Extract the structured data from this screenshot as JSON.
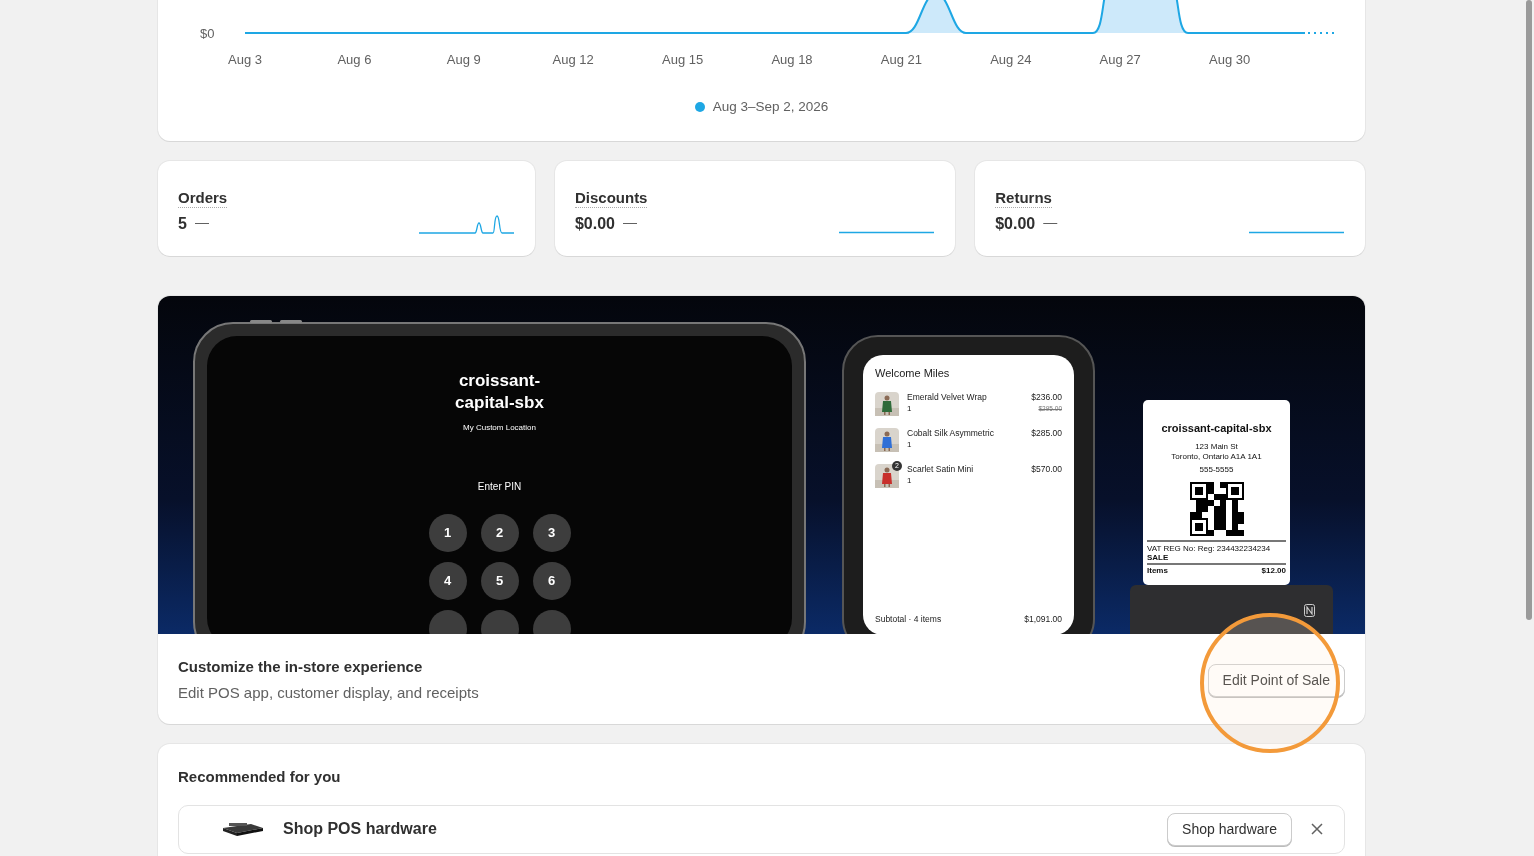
{
  "sales_chart": {
    "y_tick": "$0",
    "x_labels": [
      "Aug 3",
      "Aug 6",
      "Aug 9",
      "Aug 12",
      "Aug 15",
      "Aug 18",
      "Aug 21",
      "Aug 24",
      "Aug 27",
      "Aug 30"
    ],
    "legend": {
      "label": "Aug 3–Sep 2, 2026",
      "color": "#1ea7e4"
    }
  },
  "metrics": [
    {
      "title": "Orders",
      "value": "5",
      "change": "—",
      "kind": "peaks"
    },
    {
      "title": "Discounts",
      "value": "$0.00",
      "change": "—",
      "kind": "flat"
    },
    {
      "title": "Returns",
      "value": "$0.00",
      "change": "—",
      "kind": "flat"
    }
  ],
  "pos_promo": {
    "tablet": {
      "store_name": "croissant-capital-sbx",
      "location": "My Custom Location",
      "prompt": "Enter PIN",
      "keys": [
        "1",
        "2",
        "3",
        "4",
        "5",
        "6"
      ]
    },
    "customer_display": {
      "greeting": "Welcome Miles",
      "items": [
        {
          "name": "Emerald Velvet Wrap",
          "quantity": "1",
          "price": "$236.00",
          "original_price": "$295.00"
        },
        {
          "name": "Cobalt Silk Asymmetric",
          "quantity": "1",
          "price": "$285.00"
        },
        {
          "name": "Scarlet Satin Mini",
          "quantity": "1",
          "price": "$570.00",
          "badge": "2"
        }
      ],
      "subtotal_label": "Subtotal · 4 items",
      "subtotal": "$1,091.00"
    },
    "receipt": {
      "store_name": "croissant-capital-sbx",
      "address": [
        "123 Main St",
        "Toronto, Ontario A1A 1A1"
      ],
      "phone": "555-5555",
      "vat": "VAT REG No: Reg: 234432234234",
      "sale": "SALE",
      "line": {
        "label": "Items",
        "amount": "$12.00"
      }
    },
    "title": "Customize the in-store experience",
    "subtitle": "Edit POS app, customer display, and receipts",
    "button": "Edit Point of Sale"
  },
  "recommended": {
    "title": "Recommended for you",
    "items": [
      {
        "title": "Shop POS hardware",
        "button": "Shop hardware"
      }
    ]
  }
}
